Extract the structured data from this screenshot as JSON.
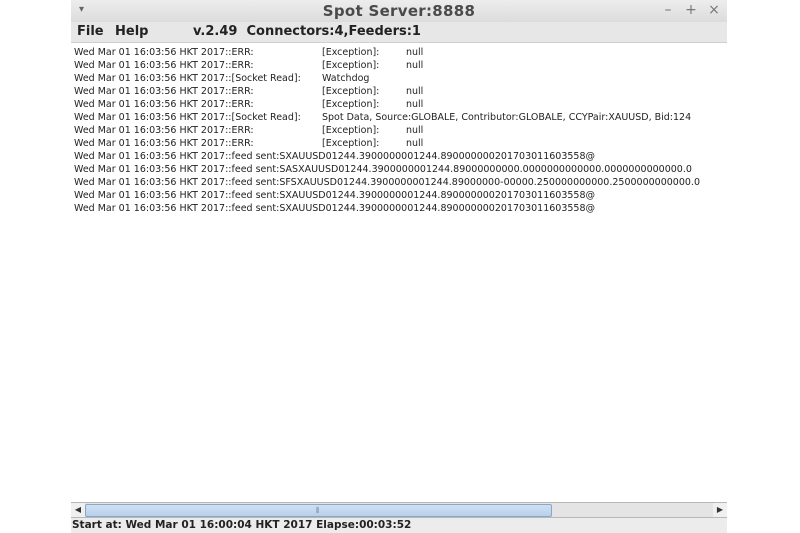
{
  "window": {
    "title": "Spot Server:8888",
    "controls": {
      "minimize": "–",
      "maximize": "+",
      "close": "×"
    },
    "window_menu_icon": "▾"
  },
  "menubar": {
    "items": [
      "File",
      "Help"
    ],
    "status": "v.2.49  Connectors:4,Feeders:1"
  },
  "log": {
    "lines": [
      {
        "stamp": "Wed Mar 01 16:03:56 HKT 2017::ERR:",
        "type": "[Exception]:",
        "msg": "null"
      },
      {
        "stamp": "Wed Mar 01 16:03:56 HKT 2017::ERR:",
        "type": "[Exception]:",
        "msg": "null"
      },
      {
        "stamp": "Wed Mar 01 16:03:56 HKT 2017::[Socket Read]:",
        "type": "Watchdog",
        "msg": ""
      },
      {
        "stamp": "Wed Mar 01 16:03:56 HKT 2017::ERR:",
        "type": "[Exception]:",
        "msg": "null"
      },
      {
        "stamp": "Wed Mar 01 16:03:56 HKT 2017::ERR:",
        "type": "[Exception]:",
        "msg": "null"
      },
      {
        "stamp": "Wed Mar 01 16:03:56 HKT 2017::[Socket Read]:",
        "type": "Spot Data, Source:GLOBALE, Contributor:GLOBALE, CCYPair:XAUUSD, Bid:124",
        "msg": ""
      },
      {
        "stamp": "Wed Mar 01 16:03:56 HKT 2017::ERR:",
        "type": "[Exception]:",
        "msg": "null"
      },
      {
        "stamp": "Wed Mar 01 16:03:56 HKT 2017::ERR:",
        "type": "[Exception]:",
        "msg": "null"
      },
      {
        "stamp": "Wed Mar 01 16:03:56 HKT 2017::feed sent:SXAUUSD01244.3900000001244.890000000201703011603558@",
        "type": "",
        "msg": ""
      },
      {
        "stamp": "Wed Mar 01 16:03:56 HKT 2017::feed sent:SASXAUUSD01244.3900000001244.89000000000.0000000000000.0000000000000.0",
        "type": "",
        "msg": ""
      },
      {
        "stamp": "Wed Mar 01 16:03:56 HKT 2017::feed sent:SFSXAUUSD01244.3900000001244.89000000-00000.250000000000.2500000000000.0",
        "type": "",
        "msg": ""
      },
      {
        "stamp": "Wed Mar 01 16:03:56 HKT 2017::feed sent:SXAUUSD01244.3900000001244.890000000201703011603558@",
        "type": "",
        "msg": ""
      },
      {
        "stamp": "Wed Mar 01 16:03:56 HKT 2017::feed sent:SXAUUSD01244.3900000001244.890000000201703011603558@",
        "type": "",
        "msg": ""
      }
    ]
  },
  "scrollbar": {
    "left_arrow": "◀",
    "right_arrow": "▶",
    "grip": "⦀",
    "thumb_fraction": 0.73
  },
  "status": {
    "text": "Start at: Wed Mar 01 16:00:04 HKT 2017 Elapse:00:03:52"
  }
}
